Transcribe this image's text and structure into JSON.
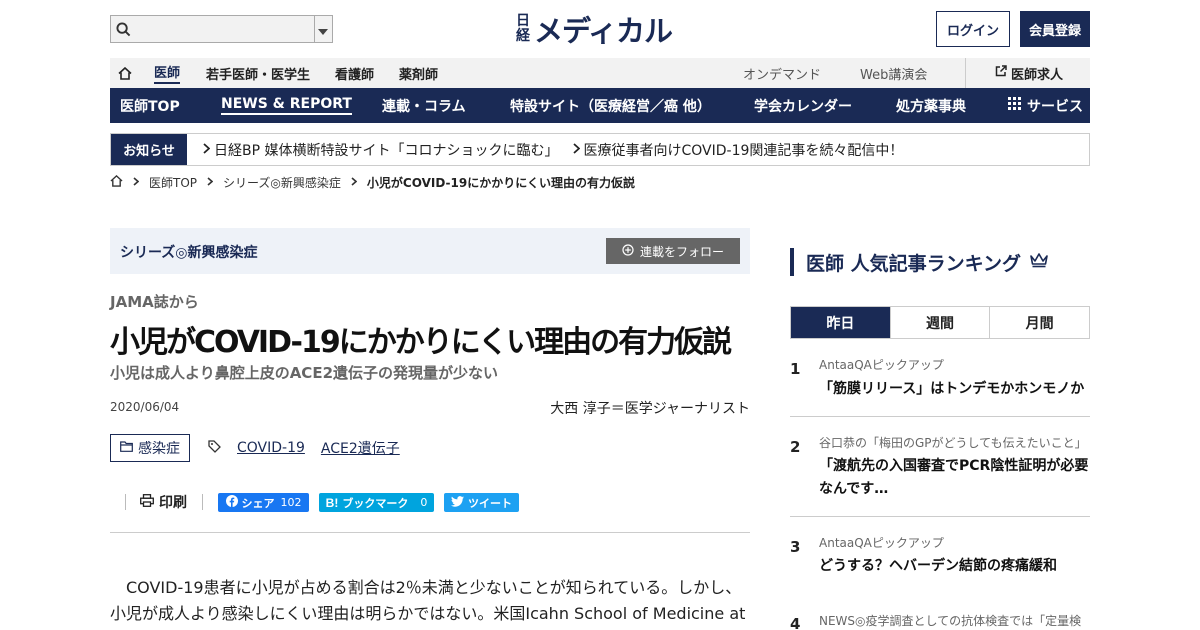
{
  "header": {
    "search_placeholder": "",
    "logo_small_top": "日",
    "logo_small_bottom": "経",
    "logo_main": "メディカル",
    "login_label": "ログイン",
    "register_label": "会員登録"
  },
  "nav1": {
    "items": [
      "医師",
      "若手医師・医学生",
      "看護師",
      "薬剤師"
    ],
    "right_items": [
      "オンデマンド",
      "Web講演会"
    ],
    "jobs_label": "医師求人"
  },
  "nav2": {
    "items": [
      "医師TOP",
      "NEWS & REPORT",
      "連載・コラム",
      "特設サイト（医療経営／癌 他）",
      "学会カレンダー",
      "処方薬事典",
      "サービス"
    ]
  },
  "notice": {
    "badge": "お知らせ",
    "links": [
      "日経BP 媒体横断特設サイト「コロナショックに臨む」",
      "医療従事者向けCOVID-19関連記事を続々配信中！"
    ]
  },
  "breadcrumb": {
    "items": [
      "医師TOP",
      "シリーズ◎新興感染症",
      "小児がCOVID-19にかかりにくい理由の有力仮説"
    ]
  },
  "article": {
    "series_label": "シリーズ◎新興感染症",
    "follow_label": "連載をフォロー",
    "kicker": "JAMA誌から",
    "title": "小児がCOVID-19にかかりにくい理由の有力仮説",
    "subtitle": "小児は成人より鼻腔上皮のACE2遺伝子の発現量が少ない",
    "date": "2020/06/04",
    "author": "大西 淳子＝医学ジャーナリスト",
    "category": "感染症",
    "tags": [
      "COVID-19",
      "ACE2遺伝子"
    ],
    "print_label": "印刷",
    "share": {
      "facebook_label": "シェア",
      "facebook_count": "102",
      "hatena_label": "ブックマーク",
      "hatena_count": "0",
      "twitter_label": "ツイート"
    },
    "body_line1": "COVID-19患者に小児が占める割合は2％未満と少ないことが知られている。しかし、",
    "body_line2": "小児が成人より感染しにくい理由は明らかではない。米国Icahn School of Medicine at"
  },
  "ranking": {
    "title": "医師 人気記事ランキング",
    "tabs": [
      "昨日",
      "週間",
      "月間"
    ],
    "active_tab": 0,
    "items": [
      {
        "num": "1",
        "source": "AntaaQAピックアップ",
        "title": "「筋膜リリース」はトンデモかホンモノか"
      },
      {
        "num": "2",
        "source": "谷口恭の「梅田のGPがどうしても伝えたいこと」",
        "title": "「渡航先の入国審査でPCR陰性証明が必要なんです…"
      },
      {
        "num": "3",
        "source": "AntaaQAピックアップ",
        "title": "どうする？ヘバーデン結節の疼痛緩和"
      },
      {
        "num": "4",
        "source": "NEWS◎疫学調査としての抗体検査では「定量検",
        "title": ""
      }
    ]
  },
  "colors": {
    "brand_navy": "#1a2a55",
    "facebook": "#1877f2",
    "hatena": "#00a4de",
    "twitter": "#1da1f2"
  }
}
